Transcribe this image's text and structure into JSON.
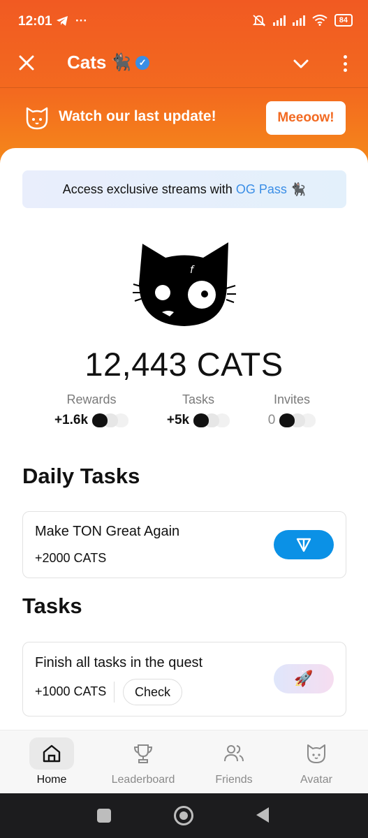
{
  "status_bar": {
    "time": "12:01",
    "battery": "84"
  },
  "app_bar": {
    "title": "Cats",
    "title_emoji": "🐈‍⬛"
  },
  "banner": {
    "text": "Watch our last update!",
    "button_label": "Meeoow!"
  },
  "og_pass": {
    "prefix": "Access exclusive streams with",
    "link_text": "OG Pass",
    "emoji": "🐈‍⬛"
  },
  "balance": {
    "text": "12,443 CATS"
  },
  "stats": [
    {
      "label": "Rewards",
      "value": "+1.6k"
    },
    {
      "label": "Tasks",
      "value": "+5k"
    },
    {
      "label": "Invites",
      "value": "0"
    }
  ],
  "daily_tasks": {
    "title": "Daily Tasks",
    "items": [
      {
        "title": "Make TON Great Again",
        "reward": "+2000 CATS"
      }
    ]
  },
  "tasks": {
    "title": "Tasks",
    "items": [
      {
        "title": "Finish all tasks in the quest",
        "reward": "+1000 CATS",
        "check_label": "Check",
        "button_emoji": "🚀"
      }
    ]
  },
  "bottom_nav": [
    {
      "label": "Home",
      "icon": "home-icon",
      "active": true
    },
    {
      "label": "Leaderboard",
      "icon": "trophy-icon",
      "active": false
    },
    {
      "label": "Friends",
      "icon": "friends-icon",
      "active": false
    },
    {
      "label": "Avatar",
      "icon": "cat-face-icon",
      "active": false
    }
  ],
  "colors": {
    "header_orange": "#f15a22",
    "accent_blue": "#3a8ee6",
    "ton_blue": "#0b91e6"
  }
}
